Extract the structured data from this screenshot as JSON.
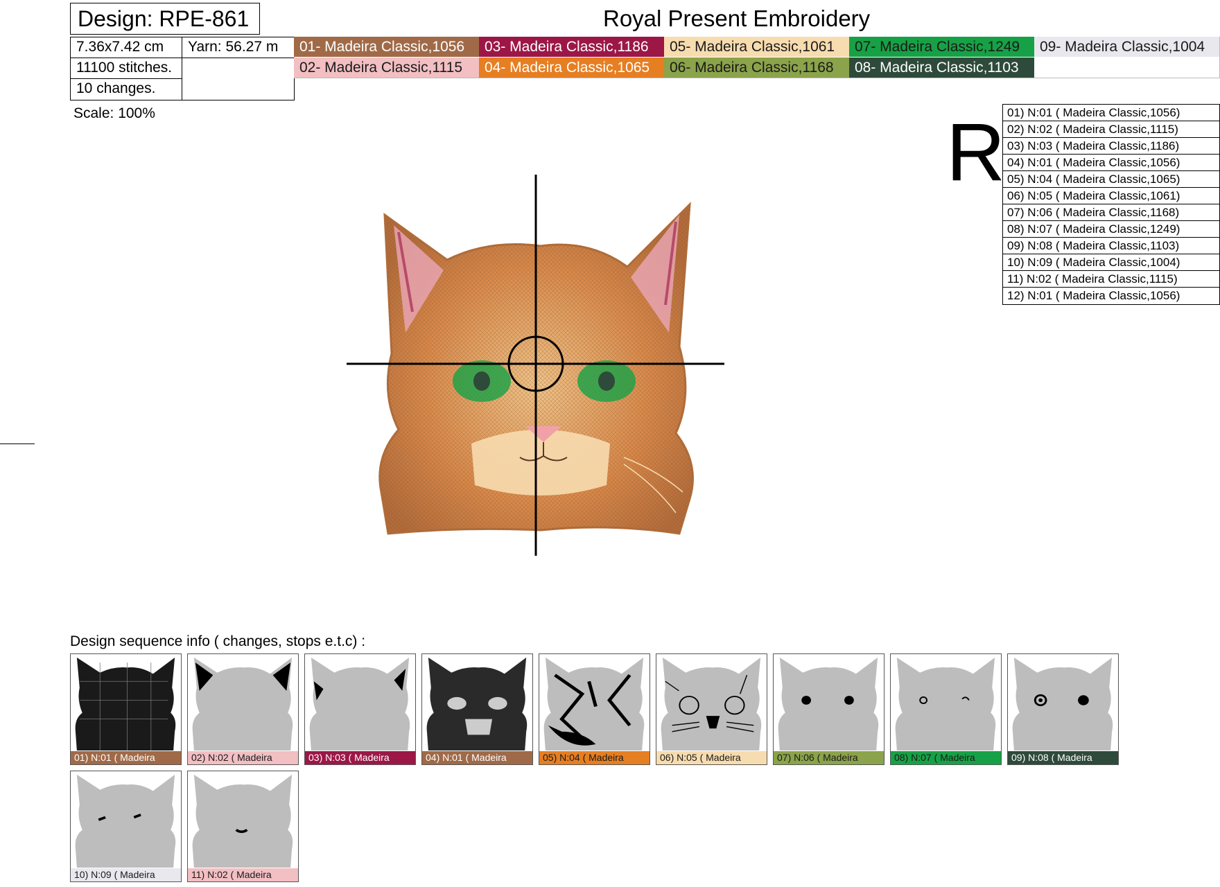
{
  "header": {
    "design_title": "Design: RPE-861",
    "company": "Royal Present Embroidery"
  },
  "info": {
    "size": "7.36x7.42 cm",
    "yarn": "Yarn: 56.27 m",
    "stitches": "11100 stitches.",
    "changes": "10 changes.",
    "scale": "Scale: 100%"
  },
  "colors": [
    {
      "label": "01- Madeira Classic,1056",
      "bg": "#a06a48",
      "fg": "#ffffff"
    },
    {
      "label": "02- Madeira Classic,1115",
      "bg": "#f2bfc2",
      "fg": "#1a1a1a"
    },
    {
      "label": "03- Madeira Classic,1186",
      "bg": "#9c1746",
      "fg": "#ffffff"
    },
    {
      "label": "04- Madeira Classic,1065",
      "bg": "#e67e22",
      "fg": "#ffffff"
    },
    {
      "label": "05- Madeira Classic,1061",
      "bg": "#f7dcaf",
      "fg": "#1a1a1a"
    },
    {
      "label": "06- Madeira Classic,1168",
      "bg": "#8ba34a",
      "fg": "#1a1a1a"
    },
    {
      "label": "07- Madeira Classic,1249",
      "bg": "#17a146",
      "fg": "#1a1a1a"
    },
    {
      "label": "08- Madeira Classic,1103",
      "bg": "#2e4a3a",
      "fg": "#ffffff"
    },
    {
      "label": "09- Madeira Classic,1004",
      "bg": "#e8e8ee",
      "fg": "#1a1a1a"
    }
  ],
  "orientation_letter": "R",
  "stop_list": [
    "01)    N:01   (  Madeira Classic,1056)",
    "02)    N:02   (  Madeira Classic,1115)",
    "03)    N:03   (  Madeira Classic,1186)",
    "04)    N:01   (  Madeira Classic,1056)",
    "05)    N:04   (  Madeira Classic,1065)",
    "06)    N:05   (  Madeira Classic,1061)",
    "07)    N:06   (  Madeira Classic,1168)",
    "08)    N:07   (  Madeira Classic,1249)",
    "09)    N:08   (  Madeira Classic,1103)",
    "10)    N:09   (  Madeira Classic,1004)",
    "11)    N:02   (  Madeira Classic,1115)",
    "12)    N:01   (  Madeira Classic,1056)"
  ],
  "sequence": {
    "title": "Design sequence info   ( changes, stops e.t.c)   :",
    "thumbs": [
      {
        "label": "01)    N:01   (  Madeira",
        "bg": "#a06a48",
        "fg": "#ffffff"
      },
      {
        "label": "02)    N:02   (  Madeira",
        "bg": "#f2bfc2",
        "fg": "#1a1a1a"
      },
      {
        "label": "03)    N:03   (  Madeira",
        "bg": "#9c1746",
        "fg": "#ffffff"
      },
      {
        "label": "04)    N:01   (  Madeira",
        "bg": "#a06a48",
        "fg": "#ffffff"
      },
      {
        "label": "05)    N:04   (  Madeira",
        "bg": "#e67e22",
        "fg": "#1a1a1a"
      },
      {
        "label": "06)    N:05   (  Madeira",
        "bg": "#f7dcaf",
        "fg": "#1a1a1a"
      },
      {
        "label": "07)    N:06   (  Madeira",
        "bg": "#8ba34a",
        "fg": "#1a1a1a"
      },
      {
        "label": "08)    N:07   (  Madeira",
        "bg": "#17a146",
        "fg": "#1a1a1a"
      },
      {
        "label": "09)    N:08   (  Madeira",
        "bg": "#2e4a3a",
        "fg": "#ffffff"
      },
      {
        "label": "10)    N:09   (  Madeira",
        "bg": "#e8e8ee",
        "fg": "#1a1a1a"
      },
      {
        "label": "11)    N:02   (  Madeira",
        "bg": "#f2bfc2",
        "fg": "#1a1a1a"
      }
    ]
  }
}
